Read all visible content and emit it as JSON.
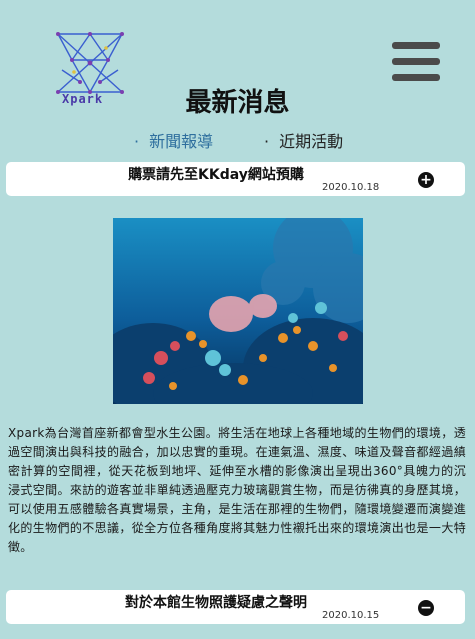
{
  "brand": {
    "name": "Xpark"
  },
  "header": {
    "title": "最新消息"
  },
  "tabs": [
    {
      "dot": "·",
      "label": "新聞報導"
    },
    {
      "dot": "·",
      "label": "近期活動"
    }
  ],
  "news": [
    {
      "title": "購票請先至KKday網站預購",
      "date": "2020.10.18",
      "toggle_icon": "plus-circle-icon",
      "toggle_symbol": "+"
    },
    {
      "title": "對於本館生物照護疑慮之聲明",
      "date": "2020.10.15",
      "toggle_icon": "minus-circle-icon",
      "toggle_symbol": "−"
    }
  ],
  "article": {
    "body": "Xpark為台灣首座新都會型水生公園。將生活在地球上各種地域的生物們的環境，透過空間演出與科技的融合，加以忠實的重現。在連氣溫、濕度、味道及聲音都經過縝密計算的空間裡，從天花板到地坪、延伸至水槽的影像演出呈現出360°具魄力的沉浸式空間。來訪的遊客並非單純透過壓克力玻璃觀賞生物，而是彷彿真的身歷其境，可以使用五感體驗各真實場景，主角，是生活在那裡的生物們，隨環境變遷而演變進化的生物們的不思議，從全方位各種角度將其魅力性襯托出來的環境演出也是一大特徵。"
  },
  "colors": {
    "background": "#b4dcdc",
    "active_tab": "#2e6f9e",
    "card": "#ffffff"
  }
}
